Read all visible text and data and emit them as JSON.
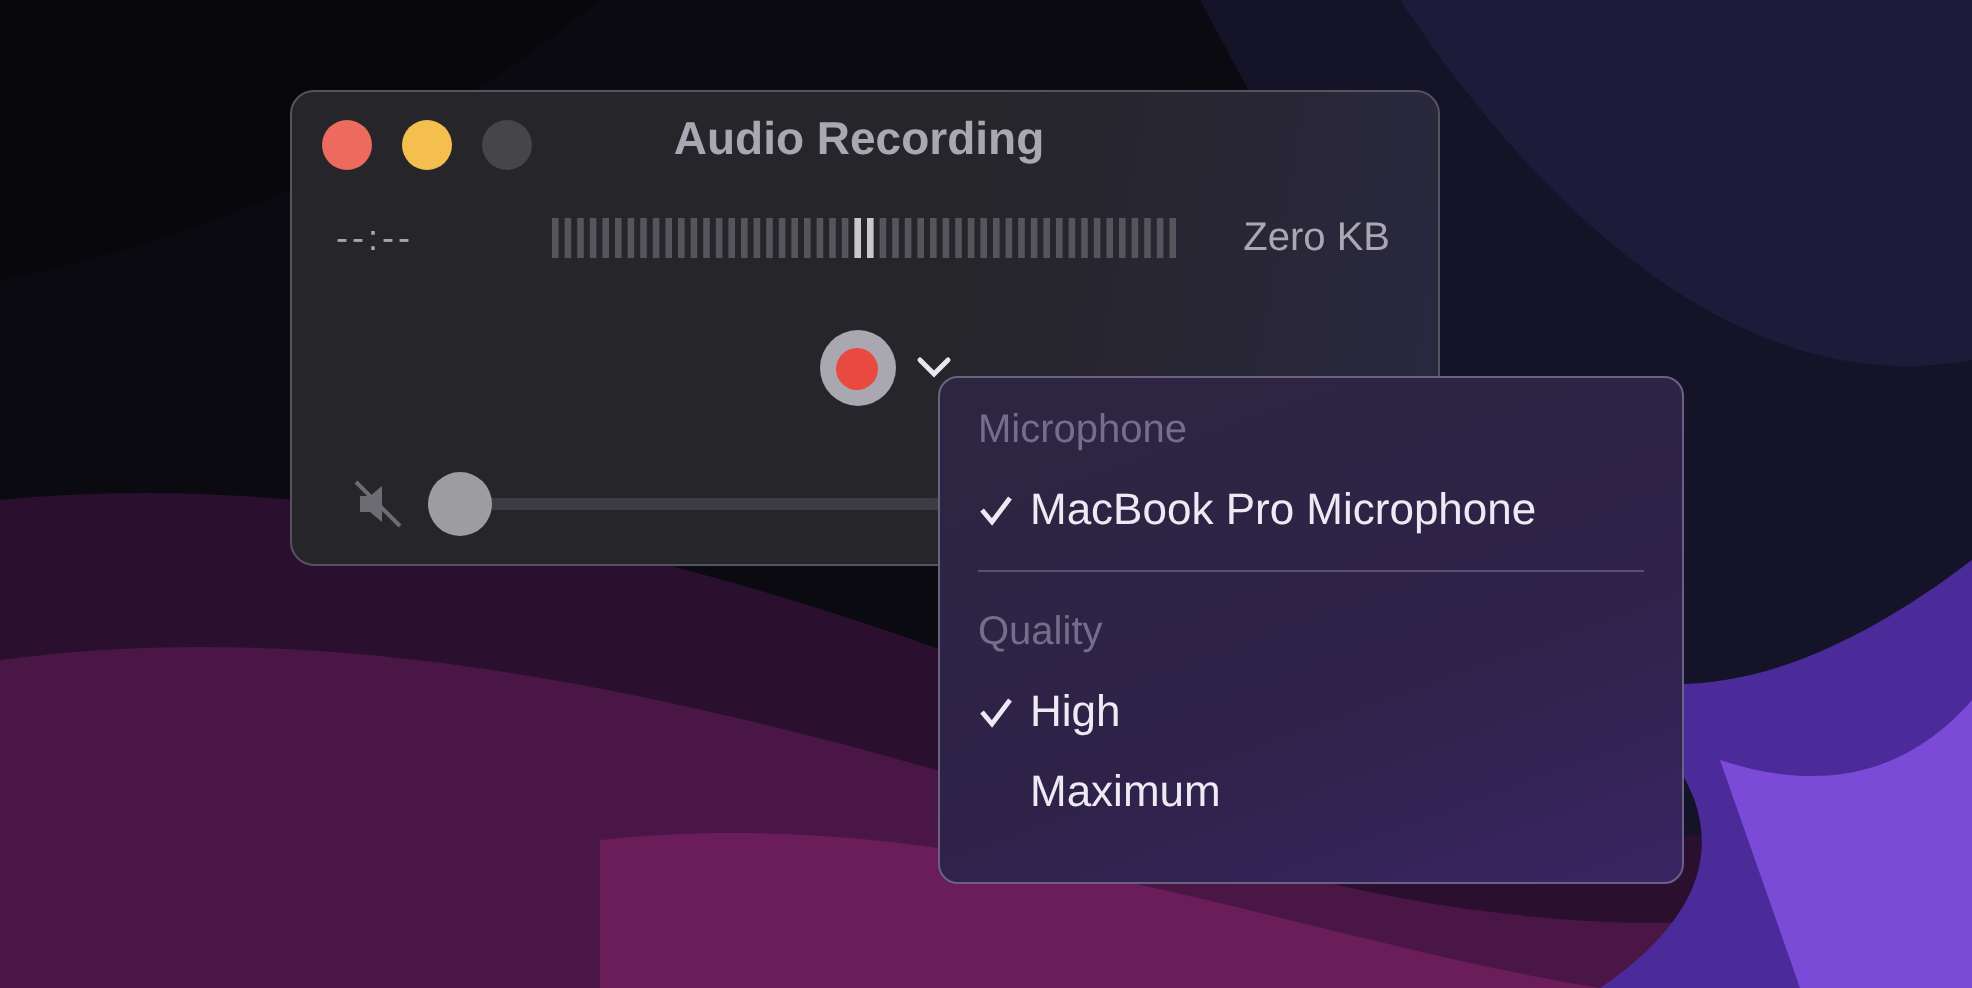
{
  "window": {
    "title": "Audio Recording",
    "time": "--:--",
    "file_size": "Zero KB",
    "volume": {
      "muted": true,
      "level": 0
    }
  },
  "menu": {
    "sections": [
      {
        "header": "Microphone",
        "items": [
          {
            "label": "MacBook Pro Microphone",
            "selected": true
          }
        ]
      },
      {
        "header": "Quality",
        "items": [
          {
            "label": "High",
            "selected": true
          },
          {
            "label": "Maximum",
            "selected": false
          }
        ]
      }
    ]
  }
}
